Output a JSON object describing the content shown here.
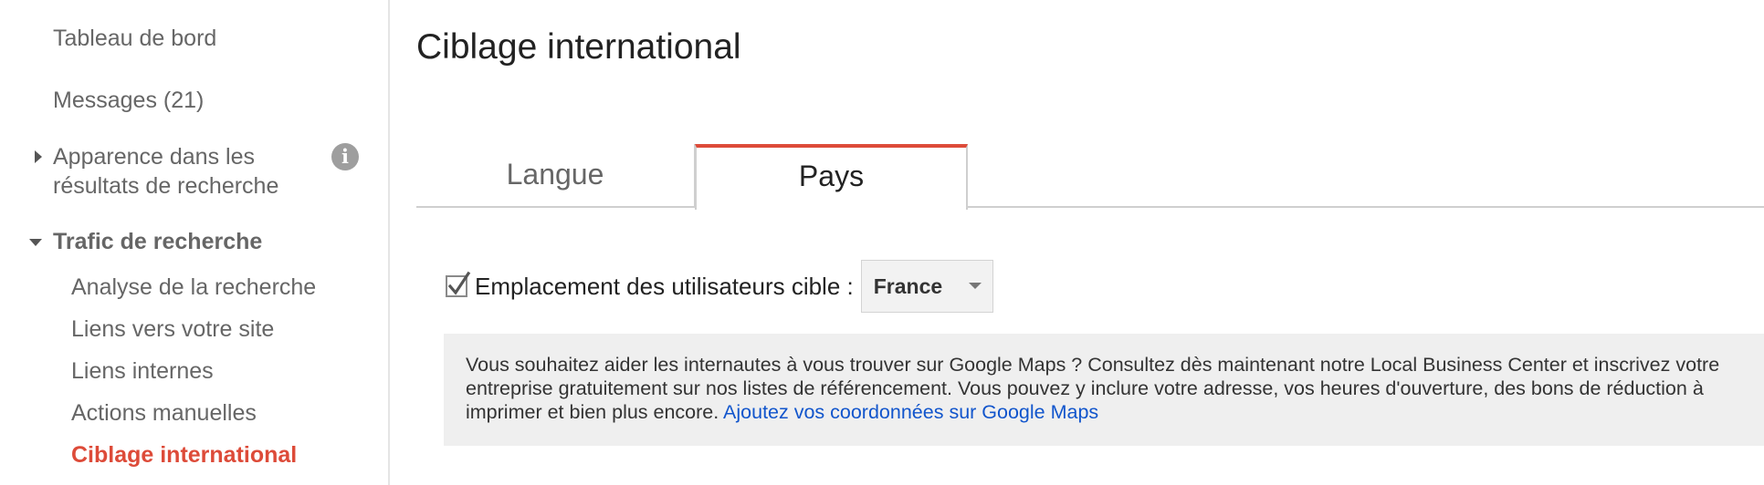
{
  "sidebar": {
    "items": [
      {
        "label": "Tableau de bord"
      },
      {
        "label": "Messages (21)"
      },
      {
        "label_line1": "Apparence dans les",
        "label_line2": "résultats de recherche"
      },
      {
        "label": "Trafic de recherche"
      },
      {
        "label": "Analyse de la recherche"
      },
      {
        "label": "Liens vers votre site"
      },
      {
        "label": "Liens internes"
      },
      {
        "label": "Actions manuelles"
      },
      {
        "label": "Ciblage international"
      }
    ],
    "info_icon": "info-icon",
    "info_glyph": "i"
  },
  "main": {
    "title": "Ciblage international",
    "tabs": [
      {
        "label": "Langue",
        "active": false
      },
      {
        "label": "Pays",
        "active": true
      }
    ],
    "target": {
      "checked": true,
      "label": "Emplacement des utilisateurs cible :",
      "selected_country": "France"
    },
    "info_box": {
      "text": "Vous souhaitez aider les internautes à vous trouver sur Google Maps ? Consultez dès maintenant notre Local Business Center et inscrivez votre entreprise gratuitement sur nos listes de référencement. Vous pouvez y inclure votre adresse, vos heures d'ouverture, des bons de réduction à imprimer et bien plus encore.",
      "link": "Ajoutez vos coordonnées sur Google Maps"
    }
  },
  "colors": {
    "accent": "#dd4b39",
    "link": "#1155cc",
    "info_box_bg": "#efefef"
  }
}
